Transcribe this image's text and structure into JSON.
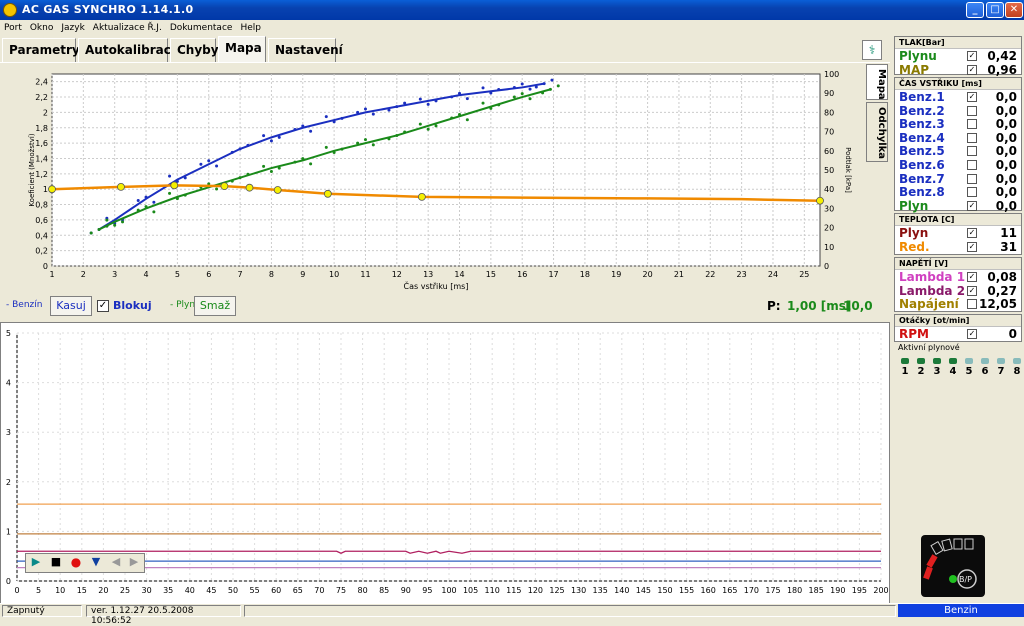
{
  "window": {
    "title": "AC GAS SYNCHRO    1.14.1.0",
    "btn_min": "_",
    "btn_max": "□",
    "btn_close": "✕"
  },
  "menu": [
    "Port",
    "Okno",
    "Jazyk",
    "Aktualizace Ř.J.",
    "Dokumentace",
    "Help"
  ],
  "tabs": [
    "Parametry",
    "Autokalibrace",
    "Chyby",
    "Mapa",
    "Nastavení"
  ],
  "active_tab": "Mapa",
  "side_tabs": [
    "Mapa",
    "Odchylka"
  ],
  "top_chart": {
    "xlabel": "Čas vstřiku [ms]",
    "ylabel_left": "Koeficient (Množství)",
    "ylabel_right": "Podtlak [kPa]",
    "x_ticks": [
      "1",
      "2",
      "3",
      "4",
      "5",
      "6",
      "7",
      "8",
      "9",
      "10",
      "11",
      "12",
      "13",
      "14",
      "15",
      "16",
      "17",
      "18",
      "19",
      "20",
      "21",
      "22",
      "23",
      "24",
      "25"
    ],
    "y_left_ticks": [
      "0",
      "0,2",
      "0,4",
      "0,6",
      "0,8",
      "1",
      "1,2",
      "1,4",
      "1,6",
      "1,8",
      "2",
      "2,2",
      "2,4"
    ],
    "y_right_ticks": [
      "0",
      "10",
      "20",
      "30",
      "40",
      "50",
      "60",
      "70",
      "80",
      "90",
      "100"
    ],
    "colors": {
      "benzin": "#1b2fc0",
      "plyn": "#1a8a1a",
      "koef": "#f08a00",
      "marker": "#f5f000"
    }
  },
  "chart_data": [
    {
      "type": "line",
      "title": "",
      "xlabel": "Čas vstřiku [ms]",
      "ylabel": "Koeficient (Množství)",
      "ylabel_right": "Podtlak [kPa]",
      "xlim": [
        1,
        25.5
      ],
      "ylim": [
        0,
        2.5
      ],
      "y_right_lim": [
        0,
        100
      ],
      "series": [
        {
          "name": "Benzín",
          "axis": "right",
          "x": [
            2.5,
            3,
            4,
            5,
            6,
            7,
            8,
            9,
            10,
            11,
            12,
            13,
            14,
            15,
            16,
            16.7
          ],
          "y": [
            19,
            24,
            35,
            45,
            53,
            61,
            67,
            72,
            76,
            80,
            83,
            86,
            89,
            91,
            93,
            95
          ]
        },
        {
          "name": "Plyn",
          "axis": "right",
          "x": [
            2.5,
            3,
            4,
            5,
            6,
            7,
            8,
            9,
            10,
            11,
            12,
            13,
            14,
            15,
            16,
            16.9
          ],
          "y": [
            19,
            23,
            30,
            36,
            41,
            46,
            51,
            55,
            60,
            64,
            68,
            73,
            78,
            83,
            88,
            92
          ]
        },
        {
          "name": "Koeficient",
          "axis": "left",
          "x": [
            1,
            3.2,
            4.9,
            6.5,
            7.3,
            8.2,
            9.8,
            12.8,
            16,
            20,
            23,
            25.5
          ],
          "y": [
            1.0,
            1.03,
            1.05,
            1.04,
            1.02,
            0.99,
            0.94,
            0.9,
            0.89,
            0.88,
            0.87,
            0.85
          ]
        }
      ],
      "markers": {
        "x": [
          1,
          3.2,
          4.9,
          6.5,
          7.3,
          8.2,
          9.8,
          12.8,
          25.5
        ],
        "y": [
          1.0,
          1.03,
          1.05,
          1.04,
          1.02,
          0.99,
          0.94,
          0.9,
          0.85
        ]
      }
    },
    {
      "type": "line",
      "title": "",
      "xlim": [
        0,
        200
      ],
      "ylim": [
        0,
        5
      ],
      "x_ticks": [
        "0",
        "5",
        "10",
        "15",
        "20",
        "25",
        "30",
        "35",
        "40",
        "45",
        "50",
        "55",
        "60",
        "65",
        "70",
        "75",
        "80",
        "85",
        "90",
        "95",
        "100",
        "105",
        "110",
        "115",
        "120",
        "125",
        "130",
        "135",
        "140",
        "145",
        "150",
        "155",
        "160",
        "165",
        "170",
        "175",
        "180",
        "185",
        "190",
        "195",
        "200"
      ],
      "y_ticks": [
        "0",
        "1",
        "2",
        "3",
        "4",
        "5"
      ],
      "series": [
        {
          "name": "Red.",
          "color": "#f0a050",
          "y_const": 1.55
        },
        {
          "name": "Plyn",
          "color": "#c08040",
          "y_const": 0.95
        },
        {
          "name": "Lambda 2",
          "color": "#b02060",
          "y_const": 0.6
        },
        {
          "name": "Lambda 1",
          "color": "#3060c0",
          "y_const": 0.4
        },
        {
          "name": "Napájení",
          "color": "#c080c0",
          "y_const": 0.27
        }
      ]
    }
  ],
  "controls": {
    "benzin_label": "- Benzín",
    "kasuj": "Kasuj",
    "blokuj": "Blokuj",
    "blokuj_check": "✓",
    "plyn_label": "- Plyn",
    "smaz": "Smaž",
    "p_label": "P:",
    "p_value": "1,00 [ms]",
    "p_value2": "10,0"
  },
  "playback": [
    "▶",
    "■",
    "●",
    "▼",
    "◀",
    "▶"
  ],
  "right_panel": {
    "tlak_header": "TLAK[Bar]",
    "tlak": [
      {
        "name": "Plynu",
        "value": "0,42",
        "color": "#1a8a1a",
        "check": "✓"
      },
      {
        "name": "MAP",
        "value": "0,96",
        "color": "#8a7a00",
        "check": "✓"
      }
    ],
    "cas_header": "ČAS VSTŘIKU [ms]",
    "cas": [
      {
        "name": "Benz.1",
        "value": "0,0",
        "color": "#1b2fc0",
        "check": "✓"
      },
      {
        "name": "Benz.2",
        "value": "0,0",
        "color": "#1b2fc0",
        "check": ""
      },
      {
        "name": "Benz.3",
        "value": "0,0",
        "color": "#1b2fc0",
        "check": ""
      },
      {
        "name": "Benz.4",
        "value": "0,0",
        "color": "#1b2fc0",
        "check": ""
      },
      {
        "name": "Benz.5",
        "value": "0,0",
        "color": "#1b2fc0",
        "check": ""
      },
      {
        "name": "Benz.6",
        "value": "0,0",
        "color": "#1b2fc0",
        "check": ""
      },
      {
        "name": "Benz.7",
        "value": "0,0",
        "color": "#1b2fc0",
        "check": ""
      },
      {
        "name": "Benz.8",
        "value": "0,0",
        "color": "#1b2fc0",
        "check": ""
      },
      {
        "name": "Plyn",
        "value": "0,0",
        "color": "#1a8a1a",
        "check": "✓"
      }
    ],
    "teplota_header": "TEPLOTA [C]",
    "teplota": [
      {
        "name": "Plyn",
        "value": "11",
        "color": "#8a1010",
        "check": "✓"
      },
      {
        "name": "Red.",
        "value": "31",
        "color": "#f08a00",
        "check": "✓"
      }
    ],
    "napeti_header": "NAPĚTÍ [V]",
    "napeti": [
      {
        "name": "Lambda 1",
        "value": "0,08",
        "color": "#d040c0",
        "check": "✓"
      },
      {
        "name": "Lambda 2",
        "value": "0,27",
        "color": "#8a1a6a",
        "check": "✓"
      },
      {
        "name": "Napájení",
        "value": "12,05",
        "color": "#a08000",
        "check": ""
      }
    ],
    "otacky_header": "Otáčky [ot/min]",
    "otacky": [
      {
        "name": "RPM",
        "value": "0",
        "color": "#d01010",
        "check": "✓"
      }
    ],
    "aktivni_label": "Aktivní plynové",
    "cylinders": [
      "1",
      "2",
      "3",
      "4",
      "5",
      "6",
      "7",
      "8"
    ],
    "logo_text": "B/P"
  },
  "status": {
    "connection": "Zapnutý",
    "version": "ver. 1.12.27  20.5.2008 10:56:52",
    "mode": "Benzin"
  }
}
